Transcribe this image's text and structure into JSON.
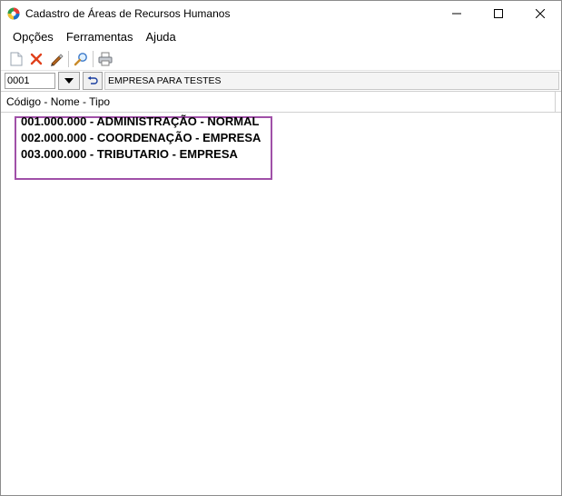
{
  "window": {
    "title": "Cadastro de Áreas de Recursos Humanos",
    "icon": "app-logo-icon",
    "controls": [
      "minimize-icon",
      "maximize-icon",
      "close-icon"
    ]
  },
  "menu": {
    "items": [
      {
        "label": "Opções"
      },
      {
        "label": "Ferramentas"
      },
      {
        "label": "Ajuda"
      }
    ]
  },
  "toolbar": {
    "buttons": [
      "new-document-icon",
      "delete-icon",
      "edit-icon",
      "search-icon",
      "print-icon"
    ]
  },
  "filter": {
    "code_value": "0001",
    "company_name": "EMPRESA PARA TESTES"
  },
  "list": {
    "header": "Código - Nome - Tipo",
    "items": [
      {
        "text": "001.000.000 - ADMINISTRAÇÃO - NORMAL"
      },
      {
        "text": "002.000.000 - COORDENAÇÃO - EMPRESA"
      },
      {
        "text": "003.000.000 - TRIBUTARIO - EMPRESA"
      }
    ],
    "highlight_color": "#a050a8"
  }
}
